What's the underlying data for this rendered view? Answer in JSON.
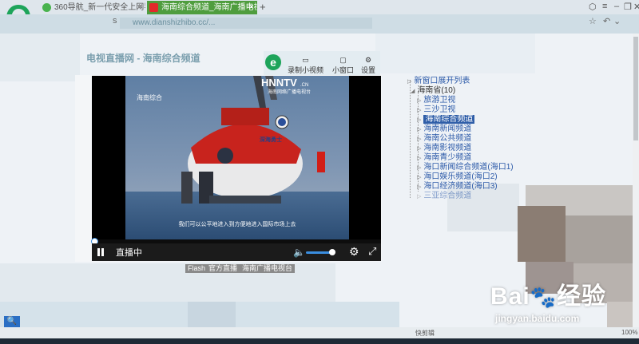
{
  "browser": {
    "tabs": [
      {
        "label": "360导航_新一代安全上网导航",
        "active": false
      },
      {
        "label": "海南综合频道_海南广播电视",
        "active": true
      }
    ],
    "new_tab": "+",
    "address": "www.dianshizhibo.cc/...",
    "address_prefix": "s",
    "win_controls": [
      "⬡",
      "≡",
      "–",
      "❐",
      "✕"
    ],
    "right_tools": [
      "☆",
      "↶",
      "⌄"
    ]
  },
  "page": {
    "title": "电视直播网 - 海南综合频道",
    "plugin_bar": {
      "logo": "e",
      "buttons": [
        "录制小视频",
        "小窗口",
        "设置"
      ]
    },
    "video": {
      "channel_logo": "海南综合",
      "station_logo": "HNNTV",
      "station_logo_suffix": ".CN",
      "station_name": "海南网络广播电视台",
      "subtitle": "我们可以公平地进入到方便地进入国际市场上去",
      "vessel_name": "深海勇士",
      "controls": {
        "live_label": "直播中",
        "progress": 0.0,
        "volume": 0.7
      }
    },
    "tags": [
      "Flash",
      "官方直播",
      "海南广播电视台"
    ],
    "tree": {
      "header": "新窗口展开列表",
      "group": "海南省(10)",
      "items": [
        "旅游卫视",
        "三沙卫视",
        "海南综合频道",
        "海南新闻频道",
        "海南公共频道",
        "海南影视频道",
        "海南青少频道",
        "海口新闻综合频道(海口1)",
        "海口娱乐频道(海口2)",
        "海口经济频道(海口3)",
        "三亚综合频道"
      ],
      "selected_index": 2
    }
  },
  "watermark": {
    "brand": "Bai",
    "brand_cn": "经验",
    "url": "jingyan.baidu.com"
  },
  "status": {
    "zoom": "100%",
    "items": [
      "快剪辑"
    ]
  },
  "colors": {
    "accent": "#2f5ea8",
    "tab_active": "#4f9d3e",
    "brand_green": "#1da45a"
  }
}
